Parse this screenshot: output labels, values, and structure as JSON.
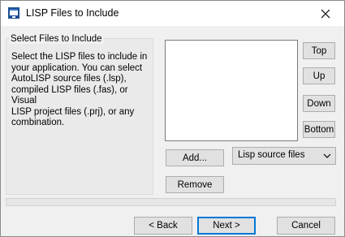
{
  "window": {
    "title": "LISP Files to Include",
    "icon": "app-window-icon",
    "close_icon": "close-icon"
  },
  "group": {
    "title": "Select Files to Include",
    "lines": [
      "Select the LISP files to include in",
      "your application.  You can select",
      "AutoLISP source files (.lsp),",
      "compiled LISP files (.fas), or Visual",
      "LISP project files (.prj), or any",
      "combination."
    ]
  },
  "file_list": {
    "items": []
  },
  "order_buttons": {
    "top": "Top",
    "up": "Up",
    "down": "Down",
    "bottom": "Bottom"
  },
  "actions": {
    "add": "Add...",
    "remove": "Remove"
  },
  "file_type": {
    "selected": "Lisp source files",
    "icon": "chevron-down-icon"
  },
  "progress": {
    "value": 0
  },
  "nav": {
    "back": "< Back",
    "next": "Next >",
    "cancel": "Cancel"
  }
}
